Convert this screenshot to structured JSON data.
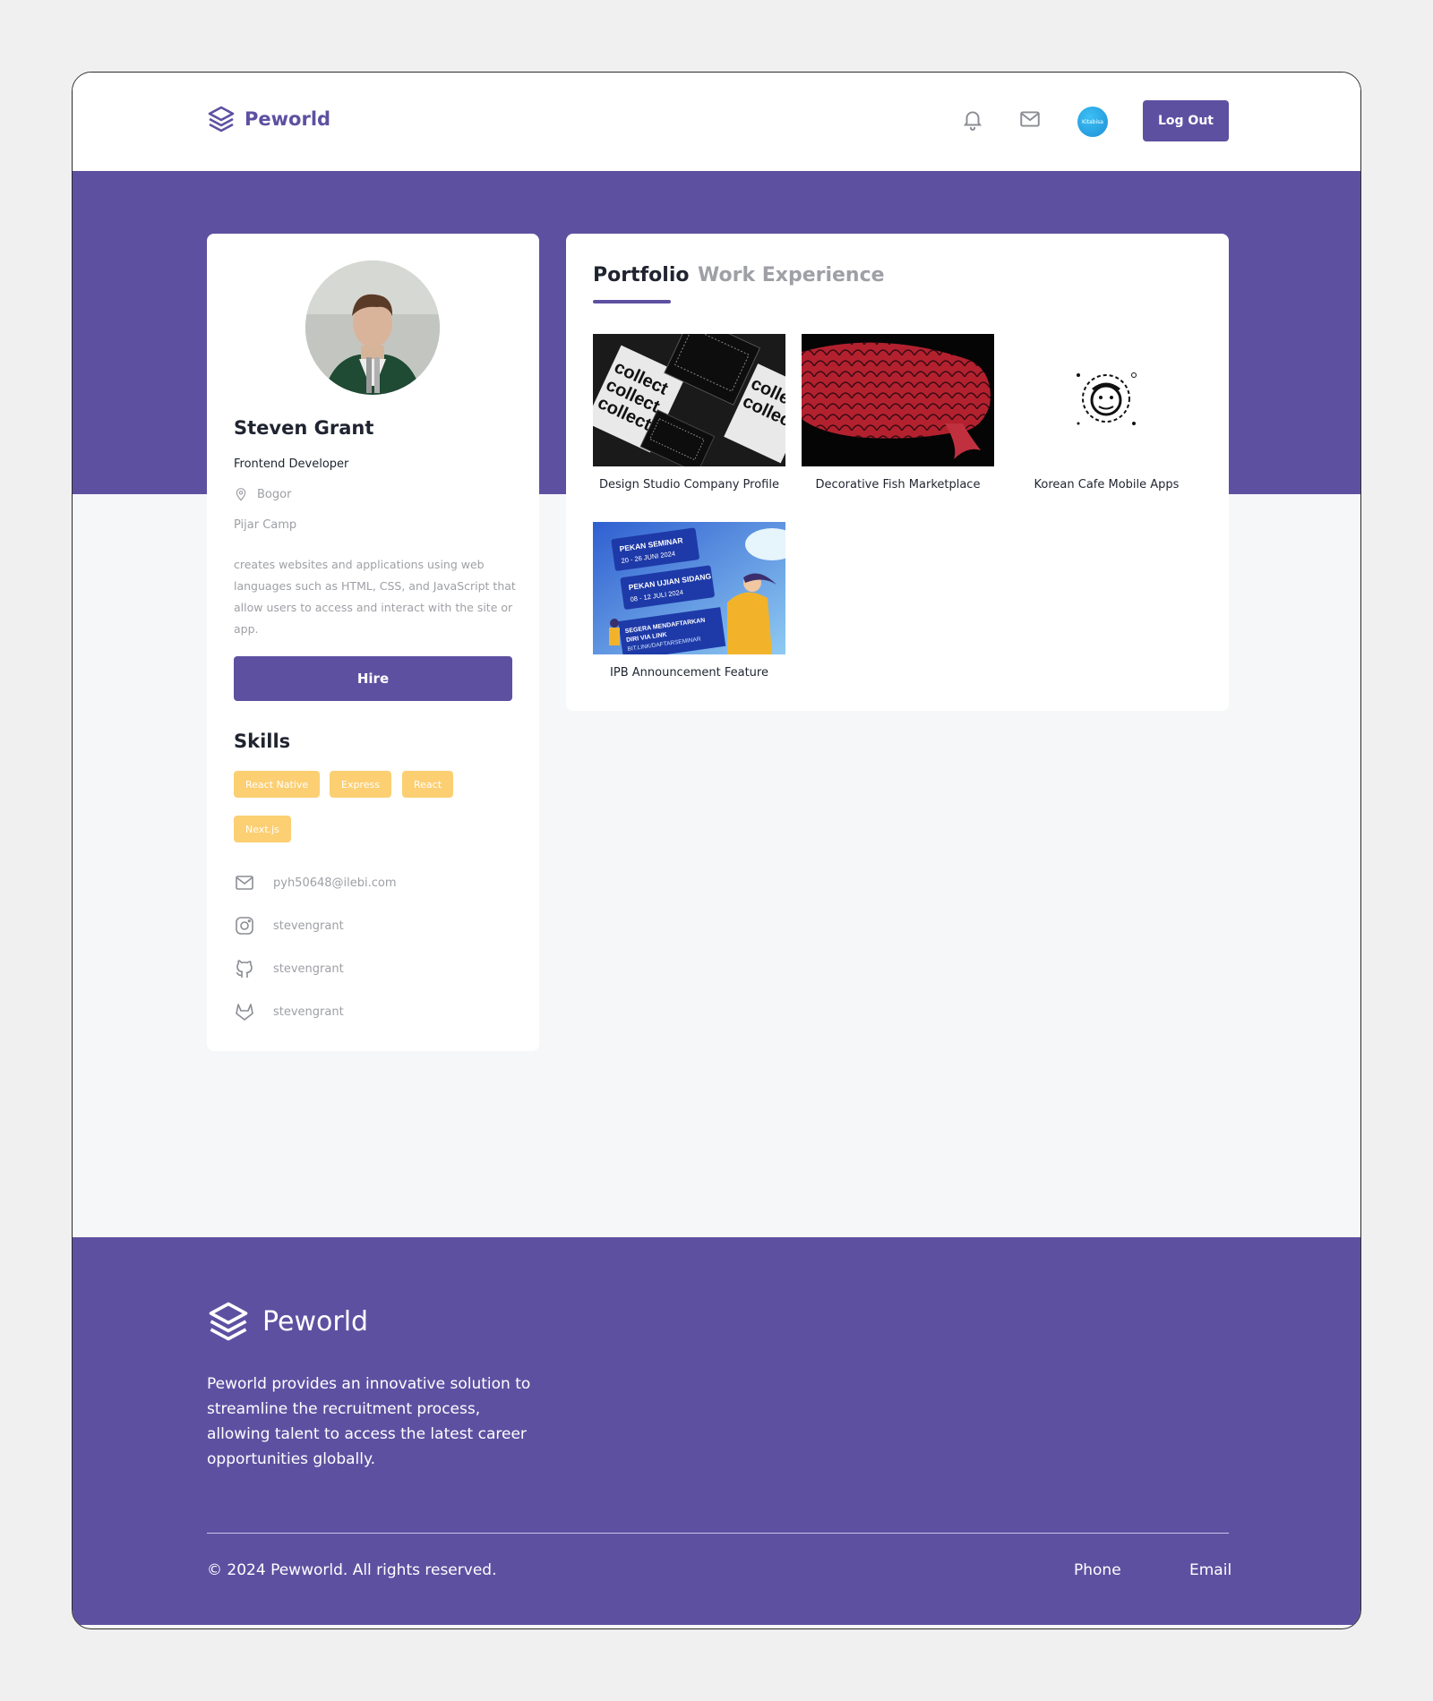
{
  "header": {
    "brand": "Peworld",
    "avatar_text": "Kitabisa",
    "logout_label": "Log Out"
  },
  "profile": {
    "name": "Steven Grant",
    "role": "Frontend Developer",
    "location": "Bogor",
    "company": "Pijar Camp",
    "bio": "creates websites and applications using web languages such as HTML, CSS, and JavaScript that allow users to access and interact with the site or app.",
    "hire_label": "Hire",
    "skills_title": "Skills",
    "skills": [
      "React Native",
      "Express",
      "React",
      "Next.js"
    ],
    "contacts": {
      "email": "pyh50648@ilebi.com",
      "instagram": "stevengrant",
      "github": "stevengrant",
      "gitlab": "stevengrant"
    }
  },
  "tabs": {
    "portfolio": "Portfolio",
    "experience": "Work Experience"
  },
  "portfolio": [
    {
      "title": "Design Studio Company Profile",
      "image_text": "collect"
    },
    {
      "title": "Decorative Fish Marketplace"
    },
    {
      "title": "Korean Cafe Mobile Apps"
    },
    {
      "title": "IPB Announcement Feature",
      "image_lines": [
        "PEKAN SEMINAR",
        "20 - 26 JUNI 2024",
        "PEKAN UJIAN SIDANG",
        "08 - 12 JULI 2024",
        "SEGERA MENDAFTARKAN",
        "DIRI VIA LINK",
        "BIT.LINK/DAFTARSEMINAR"
      ]
    }
  ],
  "footer": {
    "brand": "Peworld",
    "description": "Peworld provides an innovative solution to streamline the recruitment process, allowing talent to access the latest career opportunities globally.",
    "copyright": "© 2024 Pewworld. All rights reserved.",
    "phone_label": "Phone",
    "email_label": "Email"
  },
  "colors": {
    "brand": "#5e50a1",
    "skill_tag": "#fbb017",
    "muted_text": "#9ea0a5"
  }
}
